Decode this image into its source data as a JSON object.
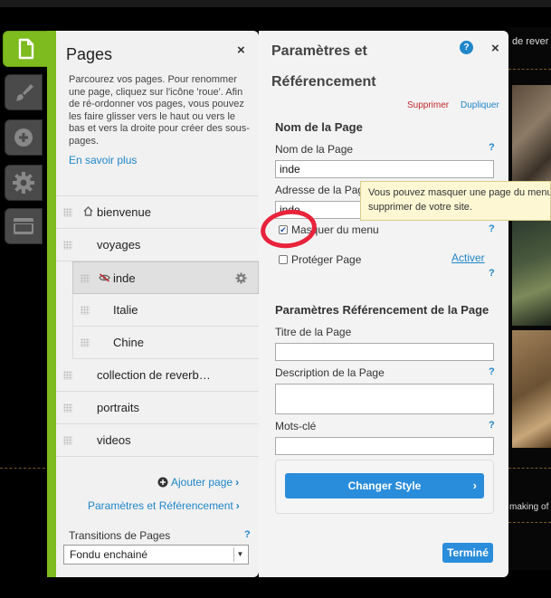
{
  "background_site": {
    "right_text_top": "de rever",
    "right_text_bottom": "making of"
  },
  "rail": {
    "items": [
      {
        "name": "pages-tab",
        "icon": "page-icon",
        "active": true
      },
      {
        "name": "design-tab",
        "icon": "paintbrush-icon",
        "active": false
      },
      {
        "name": "add-tab",
        "icon": "plus-circle-icon",
        "active": false
      },
      {
        "name": "settings-tab",
        "icon": "gear-icon",
        "active": false
      },
      {
        "name": "store-tab",
        "icon": "store-icon",
        "active": false
      }
    ]
  },
  "pages_panel": {
    "title": "Pages",
    "close": "×",
    "intro": "Parcourez vos pages. Pour renommer une page, cliquez sur l'icône 'roue'. Afin de ré-ordonner vos pages, vous pouvez les faire glisser vers le haut ou vers le bas et vers la droite pour créer des sous-pages.",
    "learn_more": "En savoir plus",
    "pages": [
      {
        "label": "bienvenue",
        "level": 0,
        "icon": "home-icon"
      },
      {
        "label": "voyages",
        "level": 0
      },
      {
        "label": "inde",
        "level": 1,
        "icon": "hidden-eye-icon",
        "selected": true
      },
      {
        "label": "Italie",
        "level": 1
      },
      {
        "label": "Chine",
        "level": 1
      },
      {
        "label": "collection de reverb…",
        "level": 0
      },
      {
        "label": "portraits",
        "level": 0
      },
      {
        "label": "videos",
        "level": 0
      }
    ],
    "add_page": "Ajouter page",
    "params_link": "Paramètres et Référencement",
    "transitions_label": "Transitions de Pages",
    "help": "?",
    "transition_value": "Fondu enchainé"
  },
  "params_panel": {
    "title": "Paramètres et Référencement",
    "info": "?",
    "close": "×",
    "delete": "Supprimer",
    "duplicate": "Dupliquer",
    "section_page": "Nom de la Page",
    "name_label": "Nom de la Page",
    "name_value": "inde",
    "address_label": "Adresse de la Page",
    "address_value": "inde",
    "hide_menu_label": "Masquer du menu",
    "hide_menu_checked": true,
    "protect_label": "Protéger Page",
    "protect_checked": false,
    "activate": "Activer",
    "section_seo": "Paramètres Référencement de la Page",
    "seo_title_label": "Titre de la Page",
    "seo_title_value": "",
    "seo_desc_label": "Description de la Page",
    "keywords_label": "Mots-clé",
    "keywords_value": "",
    "change_style": "Changer Style",
    "done": "Terminé",
    "help": "?"
  },
  "tooltip": {
    "line1": "Vous pouvez masquer une page du menu s",
    "line2": "supprimer de votre site."
  },
  "colors": {
    "accent_green": "#7dbb1e",
    "link_blue": "#1f86c9",
    "button_blue": "#2a8ddb",
    "danger_red": "#c0282d",
    "annotation_red": "#e8233b"
  }
}
